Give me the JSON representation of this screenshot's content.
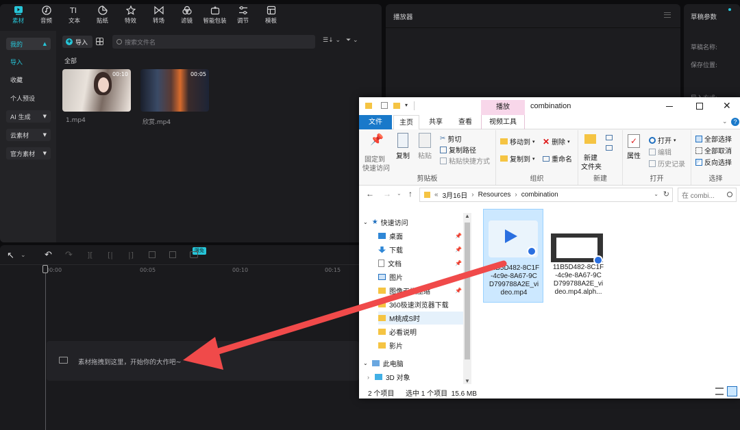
{
  "toolbar": {
    "items": [
      {
        "label": "素材",
        "icon": "media-icon"
      },
      {
        "label": "音频",
        "icon": "audio-icon"
      },
      {
        "label": "文本",
        "icon": "text-icon"
      },
      {
        "label": "贴纸",
        "icon": "sticker-icon"
      },
      {
        "label": "特效",
        "icon": "effects-icon"
      },
      {
        "label": "转场",
        "icon": "transition-icon"
      },
      {
        "label": "滤镜",
        "icon": "filter-icon"
      },
      {
        "label": "智能包装",
        "icon": "smart-pack-icon"
      },
      {
        "label": "调节",
        "icon": "adjust-icon"
      },
      {
        "label": "模板",
        "icon": "template-icon"
      }
    ]
  },
  "sidebar": {
    "mine": "我的",
    "import": "导入",
    "favorites": "收藏",
    "presets": "个人预设",
    "ai": "AI 生成",
    "cloud": "云素材",
    "official": "官方素材"
  },
  "library": {
    "import_button": "导入",
    "search_placeholder": "搜索文件名",
    "section_all": "全部",
    "clips": [
      {
        "name": "1.mp4",
        "duration": "00:10"
      },
      {
        "name": "欣赏.mp4",
        "duration": "00:05"
      }
    ]
  },
  "player": {
    "title": "播放器"
  },
  "draft": {
    "title": "草稿参数",
    "name_label": "草稿名称:",
    "location_label": "保存位置:",
    "import_label": "导入方式:"
  },
  "timeline": {
    "badge": "限免",
    "ruler": [
      "00:00",
      "00:05",
      "00:10",
      "00:15"
    ],
    "drop_hint": "素材拖拽到这里，开始你的大作吧~"
  },
  "explorer": {
    "title": "combination",
    "contextual_tab": "播放",
    "tabs": [
      "文件",
      "主页",
      "共享",
      "查看",
      "视频工具"
    ],
    "ribbon": {
      "clipboard": {
        "caption": "剪贴板",
        "pin": "固定到\n快速访问",
        "copy": "复制",
        "paste": "粘贴",
        "cut": "剪切",
        "copy_path": "复制路径",
        "paste_shortcut": "粘贴快捷方式"
      },
      "organize": {
        "caption": "组织",
        "move_to": "移动到",
        "delete": "删除",
        "copy_to": "复制到",
        "rename": "重命名"
      },
      "new": {
        "caption": "新建",
        "new_folder": "新建\n文件夹"
      },
      "open": {
        "caption": "打开",
        "properties": "属性",
        "open": "打开",
        "edit": "编辑",
        "history": "历史记录"
      },
      "select": {
        "caption": "选择",
        "select_all": "全部选择",
        "select_none": "全部取消",
        "invert": "反向选择"
      }
    },
    "address": {
      "root": "«",
      "parts": [
        "3月16日",
        "Resources",
        "combination"
      ],
      "search_placeholder": "在 combi..."
    },
    "tree": {
      "quick_access": "快速访问",
      "items": [
        "桌面",
        "下载",
        "文档",
        "图片",
        "图像无损压缩",
        "360极速浏览器下载",
        "M桃成S时",
        "必看说明",
        "影片"
      ],
      "this_pc": "此电脑",
      "objects3d": "3D 对象"
    },
    "files": [
      {
        "name": "11B5D482-8C1F-4c9e-8A67-9CD799788A2E_video.mp4",
        "lines": [
          "11B5D482-8C1F",
          "-4c9e-8A67-9C",
          "D799788A2E_vi",
          "deo.mp4"
        ]
      },
      {
        "name": "11B5D482-8C1F-4c9e-8A67-9CD799788A2E_video.mp4.alph...",
        "lines": [
          "11B5D482-8C1F",
          "-4c9e-8A67-9C",
          "D799788A2E_vi",
          "deo.mp4.alph..."
        ]
      }
    ],
    "status": {
      "count": "2 个项目",
      "selected": "选中 1 个项目  15.6 MB"
    }
  },
  "colors": {
    "accent": "#27c6d9",
    "arrow": "#f04a4a",
    "explorer_blue": "#1979ca",
    "play_tab": "#f8d7ea"
  }
}
